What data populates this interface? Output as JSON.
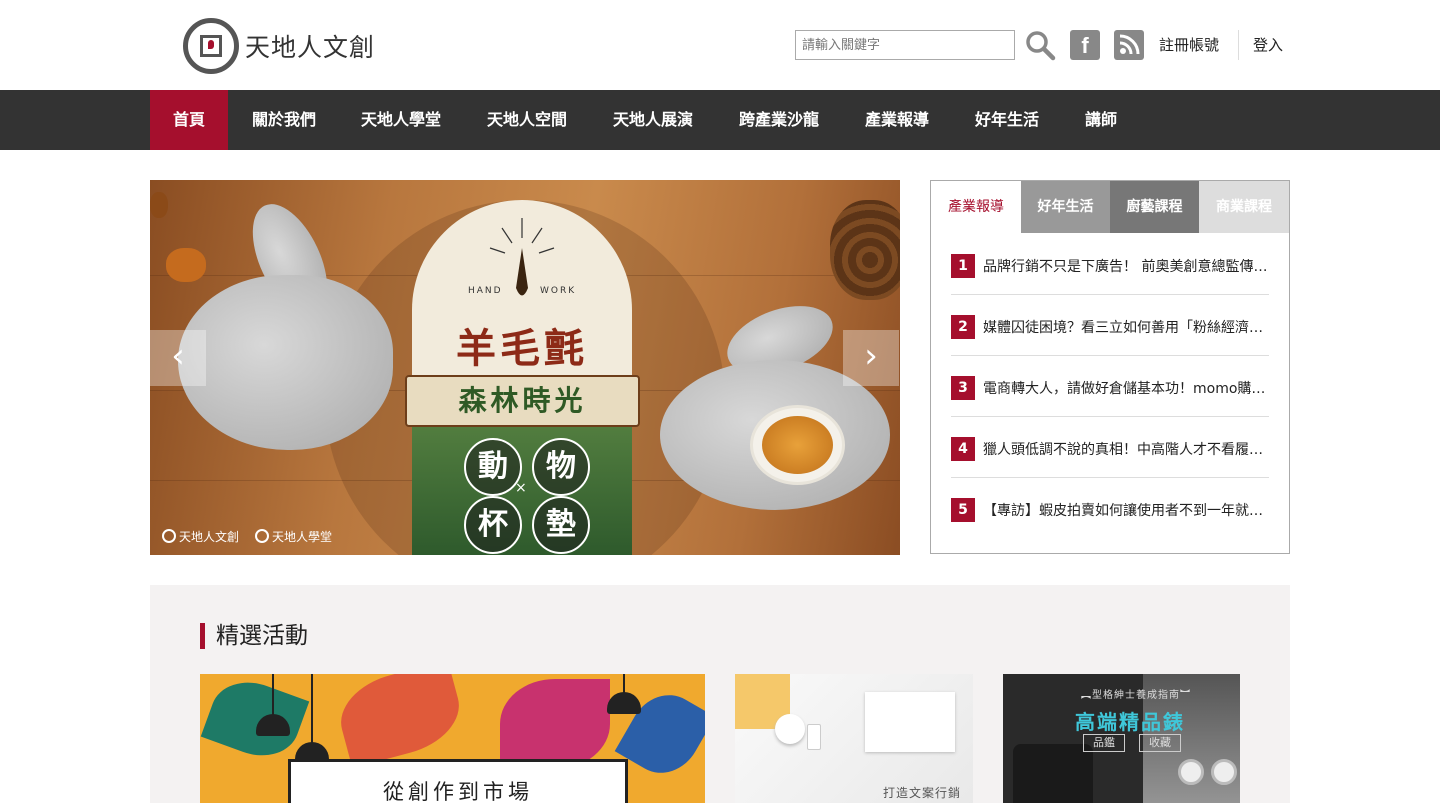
{
  "header": {
    "logo_text": "天地人文創",
    "search_placeholder": "請輸入關鍵字",
    "facebook_glyph": "f",
    "register_label": "註冊帳號",
    "login_label": "登入"
  },
  "nav": {
    "items": [
      {
        "label": "首頁",
        "active": true
      },
      {
        "label": "關於我們"
      },
      {
        "label": "天地人學堂"
      },
      {
        "label": "天地人空間"
      },
      {
        "label": "天地人展演"
      },
      {
        "label": "跨產業沙龍"
      },
      {
        "label": "產業報導"
      },
      {
        "label": "好年生活"
      },
      {
        "label": "講師"
      }
    ]
  },
  "hero": {
    "title": "羊毛氈",
    "subtitle": "森林時光",
    "ring_chars": [
      "動",
      "物",
      "杯",
      "墊"
    ],
    "cross": "×",
    "hand": "HAND",
    "work": "WORK",
    "credit_1": "天地人文創",
    "credit_2": "天地人學堂",
    "prev_glyph": "‹",
    "next_glyph": "›"
  },
  "panel": {
    "tabs": [
      "產業報導",
      "好年生活",
      "廚藝課程",
      "商業課程"
    ],
    "news": [
      {
        "num": "1",
        "text": "品牌行銷不只是下廣告！ 前奧美創意總監傳授品牌經營之道"
      },
      {
        "num": "2",
        "text": "媒體囚徒困境？看三立如何善用「粉絲經濟」找到新出路"
      },
      {
        "num": "3",
        "text": "電商轉大人，請做好倉儲基本功！momo購物網物流長分享"
      },
      {
        "num": "4",
        "text": "獵人頭低調不說的真相！中高階人才不看履歷看什麼"
      },
      {
        "num": "5",
        "text": "【專訪】蝦皮拍賣如何讓使用者不到一年就突破百萬"
      }
    ]
  },
  "featured": {
    "title": "精選活動",
    "card1_text": "從創作到市場",
    "card2_text": "打造文案行銷力",
    "card3_small": "︻型格紳士養成指南︼",
    "card3_title": "高端精品錶",
    "card3_tag1": "品鑑",
    "card3_tag2": "收藏"
  },
  "colors": {
    "brand_red": "#a50f2d",
    "nav_bg": "#333333"
  }
}
